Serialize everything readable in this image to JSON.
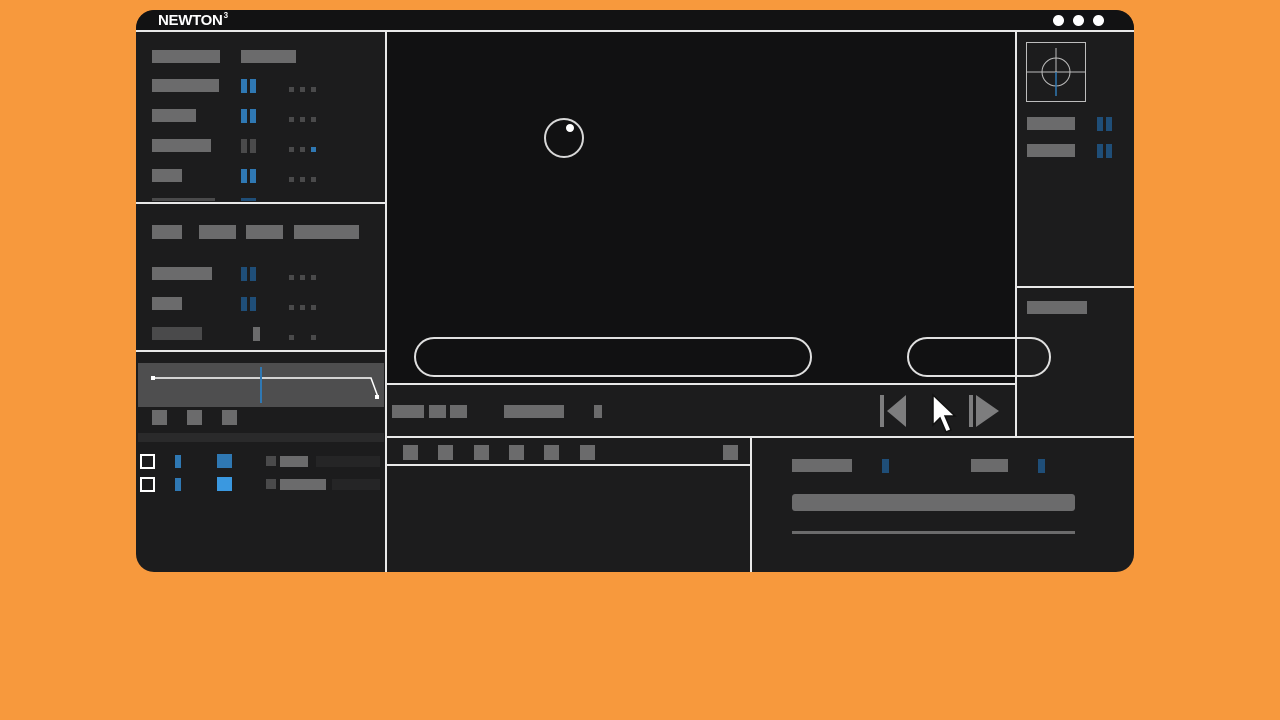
{
  "app": {
    "title": "NEWTON",
    "version": "3"
  },
  "window_controls": [
    "dot-icon",
    "dot-icon",
    "dot-icon"
  ],
  "transport": {
    "icons": [
      "skip-back-icon",
      "cursor-arrow-icon",
      "play-icon"
    ]
  },
  "inspector": {
    "icons": [
      "target-crosshair-icon"
    ]
  },
  "colors": {
    "background": "#F7993D",
    "window": "#1c1c1d",
    "viewport": "#111112",
    "accent": "#2f78b3",
    "line": "#e8e8e8"
  }
}
